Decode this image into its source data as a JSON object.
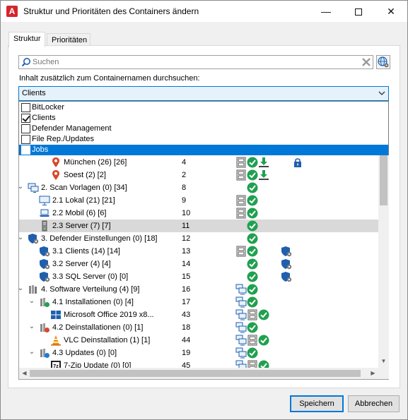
{
  "window": {
    "title": "Struktur und Prioritäten des Containers ändern",
    "app_icon": "A",
    "minimize": "—",
    "close": "✕"
  },
  "tabs": [
    {
      "label": "Struktur",
      "active": true
    },
    {
      "label": "Prioritäten",
      "active": false
    }
  ],
  "search": {
    "placeholder": "Suchen",
    "value": ""
  },
  "content_label": "Inhalt zusätzlich zum Containernamen durchsuchen:",
  "combo": {
    "value": "Clients"
  },
  "dropdown": [
    {
      "label": "BitLocker",
      "checked": false,
      "highlighted": false
    },
    {
      "label": "Clients",
      "checked": true,
      "highlighted": false
    },
    {
      "label": "Defender Management",
      "checked": false,
      "highlighted": false
    },
    {
      "label": "File Rep./Updates",
      "checked": false,
      "highlighted": false
    },
    {
      "label": "Jobs",
      "checked": false,
      "highlighted": true
    }
  ],
  "tree": [
    {
      "name": "München (26) [26]",
      "num": "4",
      "icon": "location-pin-icon",
      "level": 2,
      "expander": "",
      "cols": [
        "struct-icon",
        "check-icon",
        "download-icon",
        "",
        "lock-icon"
      ]
    },
    {
      "name": "Soest (2) [2]",
      "num": "2",
      "icon": "location-pin-icon",
      "level": 2,
      "expander": "",
      "cols": [
        "struct-icon",
        "check-icon",
        "download-icon",
        "",
        ""
      ]
    },
    {
      "name": "2. Scan Vorlagen (0) [34]",
      "num": "8",
      "icon": "monitor-group-icon",
      "level": 0,
      "expander": "⌄",
      "cols": [
        "",
        "check-icon",
        "",
        "",
        ""
      ]
    },
    {
      "name": "2.1 Lokal (21) [21]",
      "num": "9",
      "icon": "monitor-icon",
      "level": 1,
      "expander": "",
      "cols": [
        "struct-icon",
        "check-icon",
        "",
        "",
        ""
      ]
    },
    {
      "name": "2.2 Mobil (6) [6]",
      "num": "10",
      "icon": "laptop-icon",
      "level": 1,
      "expander": "",
      "cols": [
        "struct-icon",
        "check-icon",
        "",
        "",
        ""
      ]
    },
    {
      "name": "2.3 Server (7) [7]",
      "num": "11",
      "icon": "server-icon",
      "level": 1,
      "expander": "",
      "selected": true,
      "cols": [
        "",
        "check-icon",
        "",
        "",
        ""
      ]
    },
    {
      "name": "3. Defender Einstellungen (0) [18]",
      "num": "12",
      "icon": "shield-gear-icon",
      "level": 0,
      "expander": "⌄",
      "cols": [
        "",
        "check-icon",
        "",
        "",
        ""
      ]
    },
    {
      "name": "3.1 Clients (14) [14]",
      "num": "13",
      "icon": "shield-gear-icon",
      "level": 1,
      "expander": "",
      "cols": [
        "struct-icon",
        "check-icon",
        "",
        "shield-gear-icon",
        ""
      ]
    },
    {
      "name": "3.2 Server (4) [4]",
      "num": "14",
      "icon": "shield-gear-icon",
      "level": 1,
      "expander": "",
      "cols": [
        "",
        "check-icon",
        "",
        "shield-gear-icon",
        ""
      ]
    },
    {
      "name": "3.3 SQL Server (0) [0]",
      "num": "15",
      "icon": "shield-gear-icon",
      "level": 1,
      "expander": "",
      "cols": [
        "",
        "check-icon",
        "",
        "shield-gear-icon",
        ""
      ]
    },
    {
      "name": "4. Software Verteilung (4) [9]",
      "num": "16",
      "icon": "software-package-icon",
      "level": 0,
      "expander": "⌄",
      "cols": [
        "monitors-icon",
        "check-icon",
        "",
        "",
        ""
      ]
    },
    {
      "name": "4.1 Installationen (0) [4]",
      "num": "17",
      "icon": "software-install-icon",
      "level": 1,
      "expander": "⌄",
      "cols": [
        "monitors-icon",
        "check-icon",
        "",
        "",
        ""
      ]
    },
    {
      "name": "Microsoft Office 2019 x8...",
      "num": "43",
      "icon": "windows-logo-icon",
      "level": 2,
      "expander": "",
      "cols": [
        "monitors-icon",
        "struct-icon",
        "check-icon",
        "",
        ""
      ]
    },
    {
      "name": "4.2 Deinstallationen (0) [1]",
      "num": "18",
      "icon": "software-uninstall-icon",
      "level": 1,
      "expander": "⌄",
      "cols": [
        "monitors-icon",
        "check-icon",
        "",
        "",
        ""
      ]
    },
    {
      "name": "VLC Deinstallation (1) [1]",
      "num": "44",
      "icon": "vlc-cone-icon",
      "level": 2,
      "expander": "",
      "cols": [
        "monitors-icon",
        "struct-icon",
        "check-icon",
        "",
        ""
      ]
    },
    {
      "name": "4.3 Updates (0) [0]",
      "num": "19",
      "icon": "software-update-icon",
      "level": 1,
      "expander": "⌄",
      "cols": [
        "monitors-icon",
        "check-icon",
        "",
        "",
        ""
      ]
    },
    {
      "name": "7-Zip Update (0) [0]",
      "num": "45",
      "icon": "zip-icon",
      "level": 2,
      "expander": "",
      "cols": [
        "monitors-icon",
        "struct-icon",
        "check-icon",
        "",
        ""
      ]
    }
  ],
  "buttons": {
    "save": "Speichern",
    "cancel": "Abbrechen"
  },
  "colors": {
    "accent": "#0078d7",
    "check": "#20a050",
    "pin": "#d9472b",
    "shield": "#1f5fae"
  }
}
